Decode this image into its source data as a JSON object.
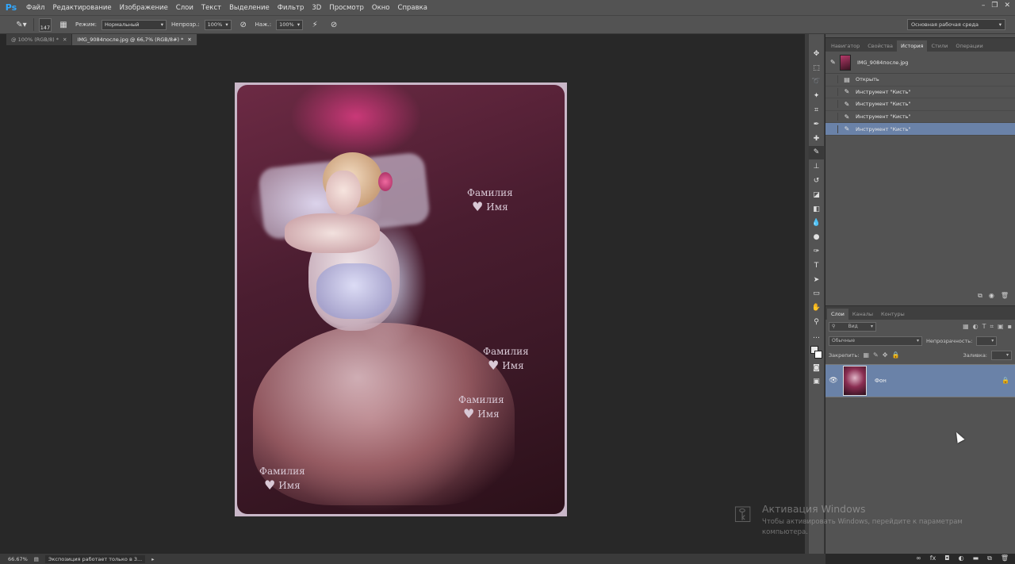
{
  "app": {
    "logo": "Ps",
    "menu": [
      "Файл",
      "Редактирование",
      "Изображение",
      "Слои",
      "Текст",
      "Выделение",
      "Фильтр",
      "3D",
      "Просмотр",
      "Окно",
      "Справка"
    ],
    "window_controls": [
      "–",
      "❐",
      "✕"
    ]
  },
  "options": {
    "brush_size": "147",
    "mode_label": "Режим:",
    "mode_value": "Нормальный",
    "opacity_label": "Непрозр.:",
    "opacity_value": "100%",
    "pressure_label": "Наж.:",
    "pressure_value": "100%",
    "workspace": "Основная рабочая среда"
  },
  "doc_tabs": [
    {
      "label": "@ 100% (RGB/8) *",
      "close": "✕"
    },
    {
      "label": "IMG_9084после.jpg @ 66,7% (RGB/8#) *",
      "close": "✕"
    }
  ],
  "document": {
    "captions": [
      {
        "surname": "Фамилия",
        "name": "Имя"
      },
      {
        "surname": "Фамилия",
        "name": "Имя"
      },
      {
        "surname": "Фамилия",
        "name": "Имя"
      },
      {
        "surname": "Фамилия",
        "name": "Имя"
      }
    ]
  },
  "history_panel": {
    "tabs": [
      "Навигатор",
      "Свойства",
      "История",
      "Стили",
      "Операции"
    ],
    "active_tab": "История",
    "snapshot": "IMG_9084после.jpg",
    "items": [
      {
        "label": "Открыть",
        "icon": "document-icon"
      },
      {
        "label": "Инструмент \"Кисть\"",
        "icon": "brush-icon"
      },
      {
        "label": "Инструмент \"Кисть\"",
        "icon": "brush-icon"
      },
      {
        "label": "Инструмент \"Кисть\"",
        "icon": "brush-icon"
      },
      {
        "label": "Инструмент \"Кисть\"",
        "icon": "brush-icon"
      }
    ]
  },
  "layers_panel": {
    "tabs": [
      "Слои",
      "Каналы",
      "Контуры"
    ],
    "active_tab": "Слои",
    "filter_label": "Вид",
    "blend_mode": "Обычные",
    "opacity_label": "Непрозрачность:",
    "lock_label": "Закрепить:",
    "fill_label": "Заливка:",
    "layers": [
      {
        "name": "Фон",
        "visible": true,
        "locked": true
      }
    ]
  },
  "status": {
    "zoom": "66.67%",
    "message": "Экспозиция работает только в 3..."
  },
  "watermark": {
    "title": "Активация Windows",
    "text": "Чтобы активировать Windows, перейдите к параметрам компьютера."
  }
}
